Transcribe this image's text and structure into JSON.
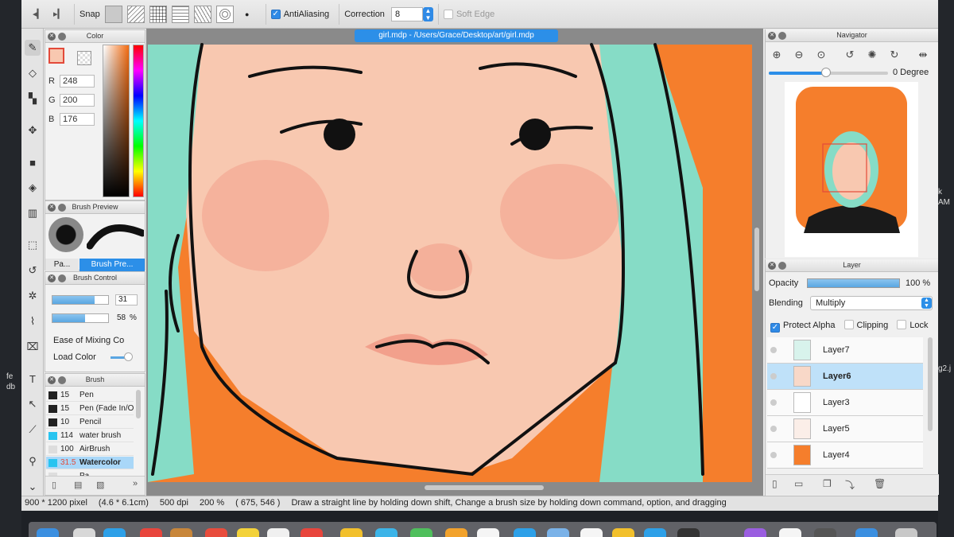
{
  "desktop": {
    "left_labels": [
      "fe",
      "db"
    ],
    "right_labels": [
      "k",
      "AM",
      "g2.j"
    ]
  },
  "toolbar": {
    "snap_label": "Snap",
    "antialiasing_label": "AntiAliasing",
    "correction_label": "Correction",
    "correction_value": "8",
    "soft_edge_label": "Soft Edge"
  },
  "document": {
    "title": "girl.mdp - /Users/Grace/Desktop/art/girl.mdp"
  },
  "color_panel": {
    "title": "Color",
    "r_label": "R",
    "r_value": "248",
    "g_label": "G",
    "g_value": "200",
    "b_label": "B",
    "b_value": "176"
  },
  "brush_preview": {
    "title": "Brush Preview",
    "tab1": "Pa...",
    "tab2": "Brush Pre..."
  },
  "brush_control": {
    "title": "Brush Control",
    "size_value": "31",
    "opacity_value": "58",
    "opacity_unit": "%",
    "size_fill": 0.75,
    "opacity_fill": 0.58,
    "ease_label": "Ease of Mixing Co",
    "load_label": "Load Color"
  },
  "brush_panel": {
    "title": "Brush",
    "items": [
      {
        "size": "15",
        "name": "Pen",
        "color": "#222222"
      },
      {
        "size": "15",
        "name": "Pen (Fade In/O",
        "color": "#222222"
      },
      {
        "size": "10",
        "name": "Pencil",
        "color": "#222222"
      },
      {
        "size": "114",
        "name": "water brush",
        "color": "#28c4f0"
      },
      {
        "size": "100",
        "name": "AirBrush",
        "color": "#dddddd"
      },
      {
        "size": "31.5",
        "name": "Watercolor",
        "color": "#28c4f0"
      },
      {
        "size": "...",
        "name": "Pa...",
        "color": "#dddddd"
      }
    ]
  },
  "navigator": {
    "title": "Navigator",
    "angle": "0 Degree",
    "zoom_fill": 0.47
  },
  "layer_panel": {
    "title": "Layer",
    "opacity_label": "Opacity",
    "opacity_value": "100 %",
    "opacity_fill": 1.0,
    "blending_label": "Blending",
    "blending_value": "Multiply",
    "protect_alpha_label": "Protect Alpha",
    "clipping_label": "Clipping",
    "lock_label": "Lock",
    "layers": [
      {
        "name": "Layer7",
        "selected": false
      },
      {
        "name": "Layer6",
        "selected": true
      },
      {
        "name": "Layer3",
        "selected": false
      },
      {
        "name": "Layer5",
        "selected": false
      },
      {
        "name": "Layer4",
        "selected": false
      }
    ]
  },
  "status_bar": {
    "size": "900 * 1200 pixel",
    "physical": "(4.6 * 6.1cm)",
    "dpi": "500 dpi",
    "zoom": "200 %",
    "coords": "( 675, 546 )",
    "hint": "Draw a straight line by holding down shift, Change a brush size by holding down command, option, and dragging"
  },
  "colors": {
    "accent": "#2c8fe8",
    "skin": "#f8c8b0",
    "hair": "#86dcc6",
    "background_orange": "#f57e2c",
    "blush": "#f2a08c"
  }
}
